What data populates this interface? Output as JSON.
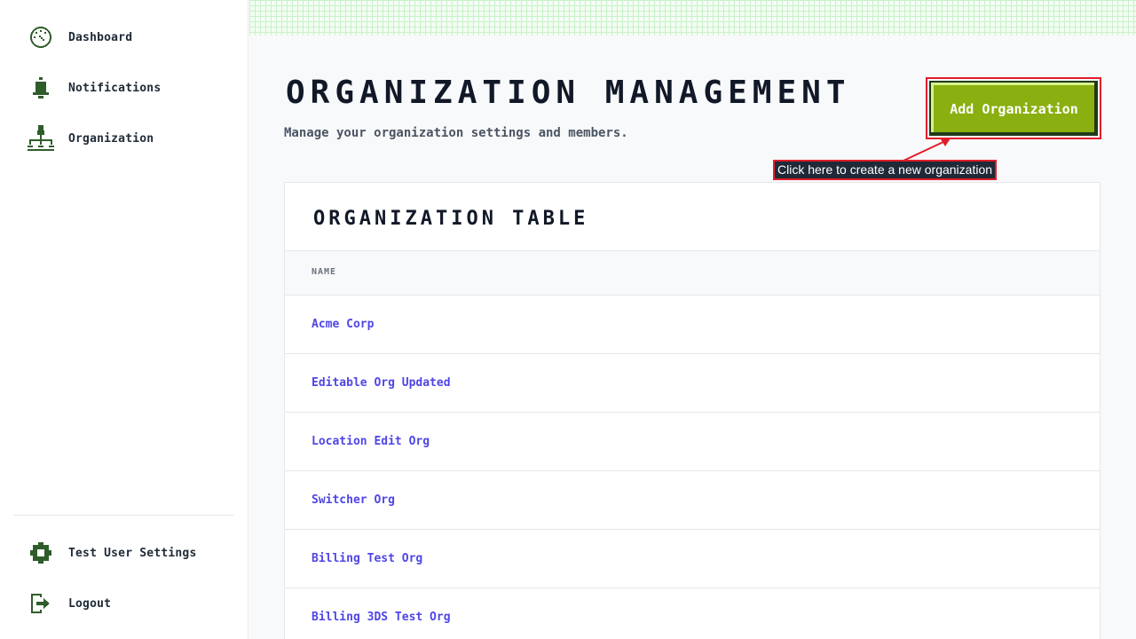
{
  "sidebar": {
    "top_items": [
      {
        "label": "Dashboard",
        "icon": "dashboard-gauge-icon"
      },
      {
        "label": "Notifications",
        "icon": "bell-icon"
      },
      {
        "label": "Organization",
        "icon": "org-tree-icon"
      }
    ],
    "bottom_items": [
      {
        "label": "Test User Settings",
        "icon": "gear-icon"
      },
      {
        "label": "Logout",
        "icon": "logout-icon"
      }
    ]
  },
  "header": {
    "title": "ORGANIZATION MANAGEMENT",
    "subtitle": "Manage your organization settings and members.",
    "add_button_label": "Add Organization"
  },
  "callout": {
    "text": "Click here to create a new organization"
  },
  "table": {
    "title": "ORGANIZATION TABLE",
    "columns": [
      "NAME"
    ],
    "rows": [
      "Acme Corp",
      "Editable Org Updated",
      "Location Edit Org",
      "Switcher Org",
      "Billing Test Org",
      "Billing 3DS Test Org"
    ]
  },
  "colors": {
    "accent_green": "#8aaf10",
    "link": "#4f46e5",
    "annotation_red": "#e11d2a",
    "icon_green": "#2f5d2a"
  }
}
